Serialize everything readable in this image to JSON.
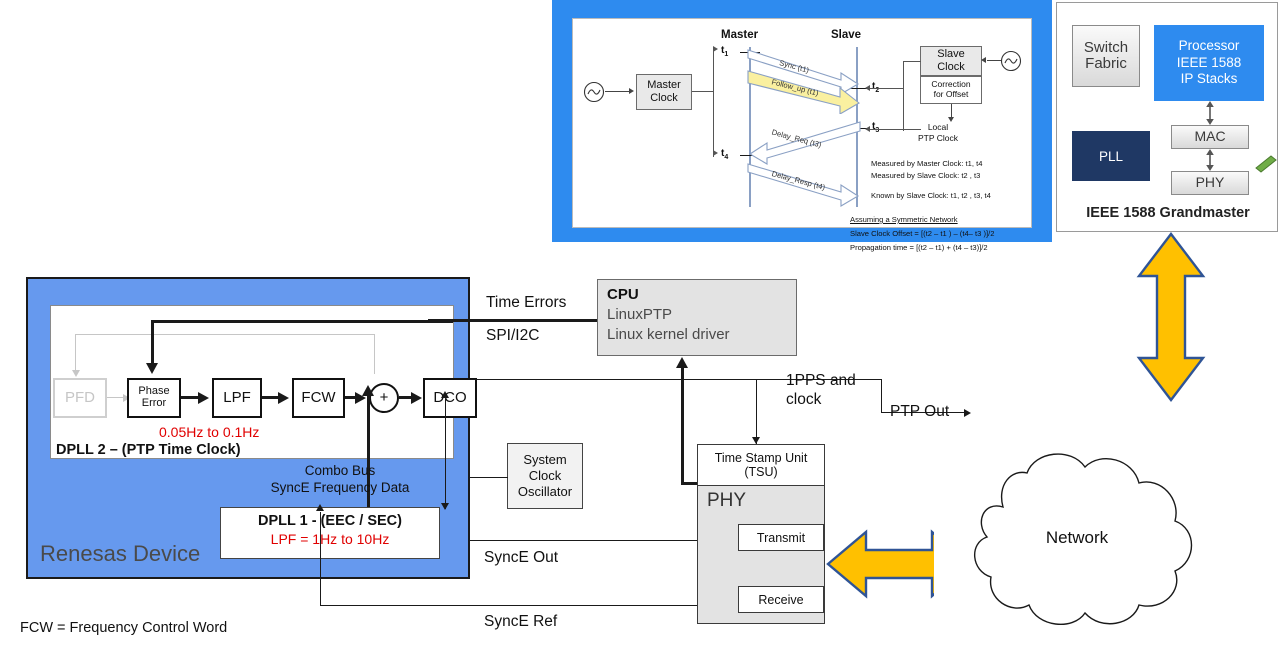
{
  "ptp_panel": {
    "master_label": "Master",
    "slave_label": "Slave",
    "master_clock": "Master\nClock",
    "slave_clock": "Slave\nClock",
    "correction": "Correction\nfor Offset",
    "local_ptp_clock": "Local\nPTP Clock",
    "osc_icon": "oscillator-icon",
    "timestamps": [
      "t1",
      "t2",
      "t3",
      "t4"
    ],
    "messages": [
      {
        "name": "Sync (t1)",
        "direction": "master-to-slave"
      },
      {
        "name": "Follow_up (t1)",
        "direction": "master-to-slave",
        "highlight": "#FAF0A0"
      },
      {
        "name": "Delay_Req (t3)",
        "direction": "slave-to-master"
      },
      {
        "name": "Delay_Resp (t4)",
        "direction": "master-to-slave"
      }
    ],
    "notes": [
      "Measured by Master Clock:  t1,  t4",
      "Measured by Slave Clock:    t2 , t3",
      "Known by Slave Clock: t1, t2 , t3, t4"
    ],
    "assumption_heading": "Assuming a Symmetric Network",
    "formula_offset": "Slave Clock Offset = [(t2 – t1 ) – (t4– t3 )]/2",
    "formula_propagation": "Propagation time = [(t2 – t1) + (t4 – t3)]/2"
  },
  "grandmaster": {
    "title": "IEEE 1588 Grandmaster",
    "switch_fabric": "Switch\nFabric",
    "processor": "Processor\nIEEE 1588\nIP Stacks",
    "pll": "PLL",
    "mac": "MAC",
    "phy": "PHY",
    "led_icon": "green-connector-icon",
    "colors": {
      "processor_blue": "#2E8BEF",
      "pll_navy": "#1F3864",
      "led_green": "#70AD47"
    }
  },
  "renesas": {
    "device_label": "Renesas Device",
    "device_color": "#6699EE",
    "dpll2": {
      "title": "DPLL 2 – (PTP Time Clock)",
      "bandwidth": "0.05Hz to 0.1Hz",
      "blocks": [
        {
          "label": "PFD",
          "state": "disabled"
        },
        {
          "label": "Phase\nError",
          "state": "active"
        },
        {
          "label": "LPF",
          "state": "active"
        },
        {
          "label": "FCW",
          "state": "active"
        },
        {
          "label": "+",
          "state": "summing-junction"
        },
        {
          "label": "DCO",
          "state": "active"
        }
      ]
    },
    "dpll1": {
      "title": "DPLL 1 - (EEC / SEC)",
      "bandwidth": "LPF = 1Hz to 10Hz"
    },
    "combo_bus": "Combo Bus\nSyncE Frequency Data"
  },
  "signals": {
    "time_errors": "Time Errors",
    "spi_i2c": "SPI/I2C",
    "pps_clock": "1PPS and\nclock",
    "ptp_out": "PTP Out",
    "synce_out": "SyncE Out",
    "synce_ref": "SyncE Ref"
  },
  "cpu": {
    "title": "CPU",
    "line1": "LinuxPTP",
    "line2": "Linux kernel driver"
  },
  "phy_block": {
    "tsu": "Time Stamp Unit\n(TSU)",
    "phy": "PHY",
    "transmit": "Transmit",
    "receive": "Receive"
  },
  "network": {
    "label": "Network"
  },
  "footnote": "FCW = Frequency Control Word",
  "arrow_colors": {
    "orange_fill": "#FFC000",
    "orange_stroke": "#2F5496"
  }
}
